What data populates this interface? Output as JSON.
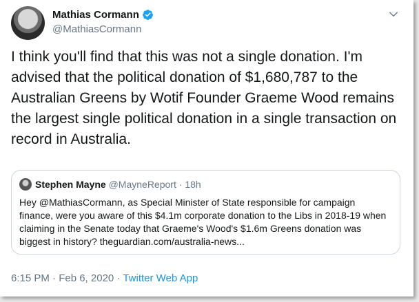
{
  "tweet": {
    "author": {
      "display_name": "Mathias Cormann",
      "handle": "@MathiasCormann",
      "verified_icon": "verified-badge-icon"
    },
    "text": "I think you'll find that this was not a single donation. I'm advised that the political donation of $1,680,787 to the Australian Greens by Wotif Founder Graeme Wood remains the largest single political donation in a single transaction on record in Australia.",
    "timestamp": "6:15 PM · Feb 6, 2020",
    "separator": "·",
    "source": "Twitter Web App"
  },
  "quoted_tweet": {
    "display_name": "Stephen Mayne",
    "handle": "@MayneReport",
    "dot": "·",
    "age": "18h",
    "text": "Hey @MathiasCormann, as Special Minister of State responsible for campaign finance, were you aware of this $4.1m corporate donation to the Libs in 2018-19 when claiming in the Senate today that Graeme's Wood's $1.6m Greens donation was biggest in history? theguardian.com/australia-news..."
  },
  "colors": {
    "text": "#14171a",
    "secondary": "#657786",
    "link": "#1b95e0",
    "border": "#ccd6dd",
    "verified": "#1da1f2"
  },
  "icons": {
    "more": "chevron-down-icon"
  }
}
